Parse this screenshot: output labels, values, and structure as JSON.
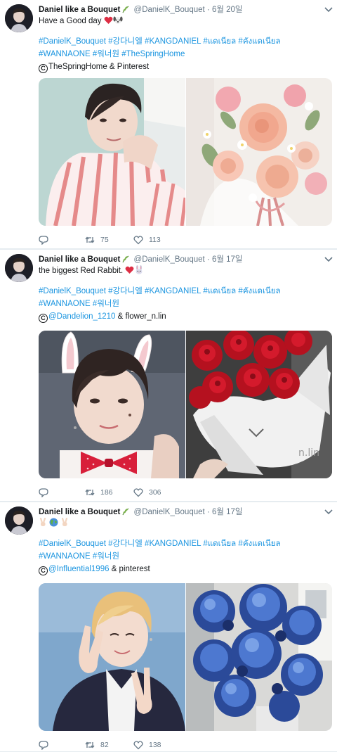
{
  "colors": {
    "link": "#1b95e0",
    "muted": "#657786",
    "text": "#14171a",
    "divider": "#e6ecf0"
  },
  "tweets": [
    {
      "name": "Daniel like a Bouquet",
      "handle": "@DanielK_Bouquet",
      "sep": "·",
      "date": "6월 20일",
      "text": "Have a Good day",
      "text_emoji": [
        "heart-icon",
        "dog-face-icon"
      ],
      "hashtags": [
        "#DanielK_Bouquet",
        "#강다니엘",
        "#KANGDANIEL",
        "#แดเนียล",
        "#คังแดเนียล",
        "#WANNAONE",
        "#워너원",
        "#TheSpringHome"
      ],
      "credit_mark": "C",
      "credit_mention": "",
      "credit_text": "TheSpringHome & Pinterest",
      "images": [
        "portrait-striped-shirt",
        "peach-peony-bouquet"
      ],
      "retweets": "75",
      "likes": "113"
    },
    {
      "name": "Daniel like a Bouquet",
      "handle": "@DanielK_Bouquet",
      "sep": "·",
      "date": "6월 17일",
      "text": "the biggest Red Rabbit.",
      "text_emoji": [
        "heart-icon",
        "rabbit-face-icon"
      ],
      "hashtags": [
        "#DanielK_Bouquet",
        "#강다니엘",
        "#KANGDANIEL",
        "#แดเนียล",
        "#คังแดเนียล",
        "#WANNAONE",
        "#워너원"
      ],
      "credit_mark": "C",
      "credit_mention": "@Dandelion_1210",
      "credit_text": " & flower_n.lin",
      "images": [
        "portrait-bunny-ears",
        "red-rose-bouquet"
      ],
      "retweets": "186",
      "likes": "306"
    },
    {
      "name": "Daniel like a Bouquet",
      "handle": "@DanielK_Bouquet",
      "sep": "·",
      "date": "6월 17일",
      "text": "",
      "text_emoji": [
        "victory-hand-icon",
        "globe-icon",
        "victory-hand-icon"
      ],
      "hashtags": [
        "#DanielK_Bouquet",
        "#강다니엘",
        "#KANGDANIEL",
        "#แดเนียล",
        "#คังแดเนียล",
        "#WANNAONE",
        "#워너원"
      ],
      "credit_mark": "C",
      "credit_mention": "@Influential1996",
      "credit_text": " & pinterest",
      "images": [
        "portrait-peace-sign",
        "blue-hydrangea-vase"
      ],
      "retweets": "82",
      "likes": "138"
    }
  ]
}
